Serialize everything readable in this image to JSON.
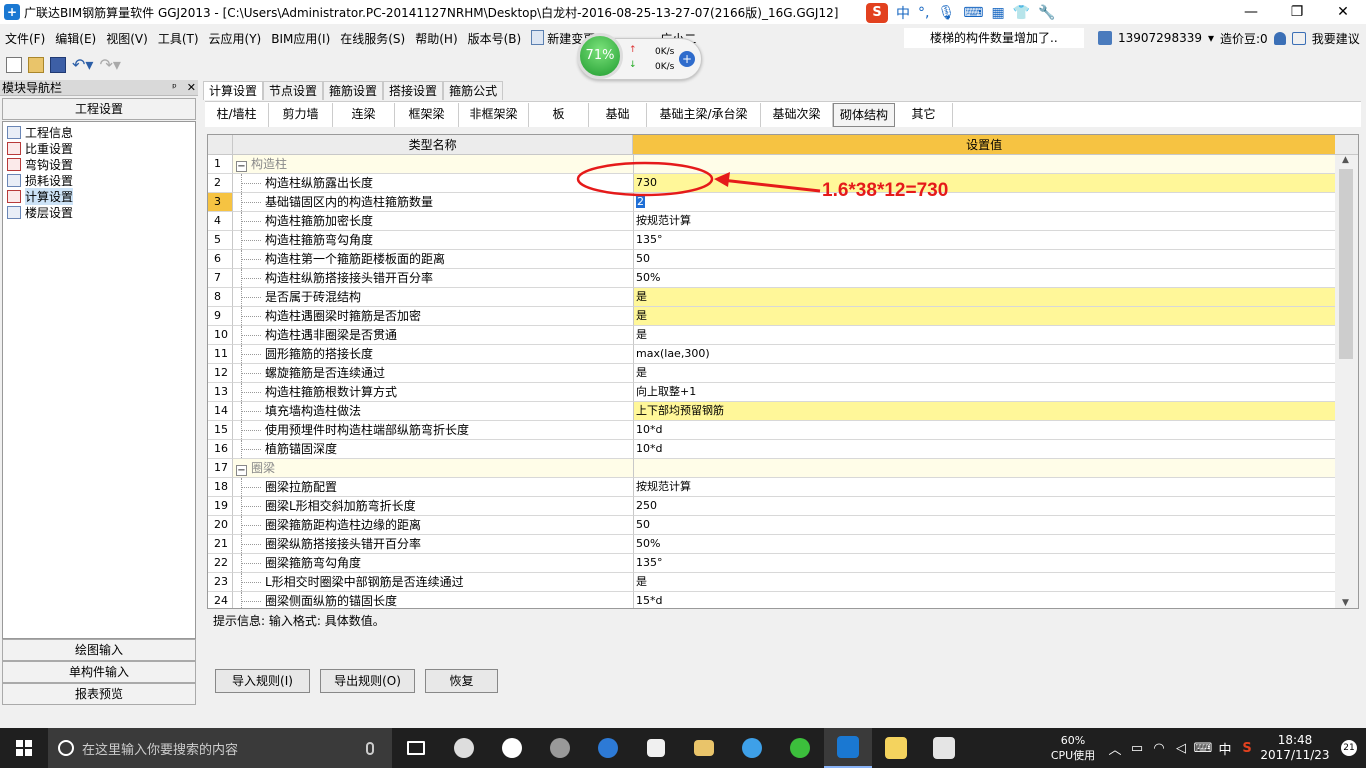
{
  "window": {
    "title": "广联达BIM钢筋算量软件 GGJ2013 - [C:\\Users\\Administrator.PC-20141127NRHM\\Desktop\\白龙村-2016-08-25-13-27-07(2166版)_16G.GGJ12]",
    "ime_items": [
      "中",
      "°,",
      "🎙",
      "⌨",
      "▦",
      "👕",
      "🔧"
    ],
    "minimize": "—",
    "maximize": "❐",
    "close": "✕"
  },
  "menu": {
    "items": [
      "文件(F)",
      "编辑(E)",
      "视图(V)",
      "工具(T)",
      "云应用(Y)",
      "BIM应用(I)",
      "在线服务(S)",
      "帮助(H)",
      "版本号(B)",
      "新建变更",
      "广小二"
    ],
    "notice": "楼梯的构件数量增加了..",
    "phone": "13907298339",
    "cost_beans": "造价豆:0",
    "help": "我要建议"
  },
  "speed": {
    "percent": "71%",
    "up": "0K/s",
    "down": "0K/s",
    "plus": "+"
  },
  "nav": {
    "title": "模块导航栏",
    "pin": "ᵖ",
    "close": "✕",
    "section": "工程设置",
    "items": [
      "工程信息",
      "比重设置",
      "弯钩设置",
      "损耗设置",
      "计算设置",
      "楼层设置"
    ],
    "bottom": [
      "绘图输入",
      "单构件输入",
      "报表预览"
    ]
  },
  "tabs_top": [
    "计算设置",
    "节点设置",
    "箍筋设置",
    "搭接设置",
    "箍筋公式"
  ],
  "tabs_sub": [
    "柱/墙柱",
    "剪力墙",
    "连梁",
    "框架梁",
    "非框架梁",
    "板",
    "基础",
    "基础主梁/承台梁",
    "基础次梁",
    "砌体结构",
    "其它"
  ],
  "grid": {
    "head_name": "类型名称",
    "head_value": "设置值",
    "rows": [
      {
        "n": "1",
        "name": "构造柱",
        "value": "",
        "group": true
      },
      {
        "n": "2",
        "name": "构造柱纵筋露出长度",
        "value": "730",
        "hl": true
      },
      {
        "n": "3",
        "name": "基础锚固区内的构造柱箍筋数量",
        "value": "2",
        "edit": true
      },
      {
        "n": "4",
        "name": "构造柱箍筋加密长度",
        "value": "按规范计算"
      },
      {
        "n": "5",
        "name": "构造柱箍筋弯勾角度",
        "value": "135°"
      },
      {
        "n": "6",
        "name": "构造柱第一个箍筋距楼板面的距离",
        "value": "50"
      },
      {
        "n": "7",
        "name": "构造柱纵筋搭接接头错开百分率",
        "value": "50%"
      },
      {
        "n": "8",
        "name": "是否属于砖混结构",
        "value": "是",
        "hl": true
      },
      {
        "n": "9",
        "name": "构造柱遇圈梁时箍筋是否加密",
        "value": "是",
        "hl": true
      },
      {
        "n": "10",
        "name": "构造柱遇非圈梁是否贯通",
        "value": "是"
      },
      {
        "n": "11",
        "name": "圆形箍筋的搭接长度",
        "value": "max(lae,300)"
      },
      {
        "n": "12",
        "name": "螺旋箍筋是否连续通过",
        "value": "是"
      },
      {
        "n": "13",
        "name": "构造柱箍筋根数计算方式",
        "value": "向上取整+1"
      },
      {
        "n": "14",
        "name": "填充墙构造柱做法",
        "value": "上下部均预留钢筋",
        "hl": true
      },
      {
        "n": "15",
        "name": "使用预埋件时构造柱端部纵筋弯折长度",
        "value": "10*d"
      },
      {
        "n": "16",
        "name": "植筋锚固深度",
        "value": "10*d"
      },
      {
        "n": "17",
        "name": "圈梁",
        "value": "",
        "group": true
      },
      {
        "n": "18",
        "name": "圈梁拉筋配置",
        "value": "按规范计算"
      },
      {
        "n": "19",
        "name": "圈梁L形相交斜加筋弯折长度",
        "value": "250"
      },
      {
        "n": "20",
        "name": "圈梁箍筋距构造柱边缘的距离",
        "value": "50"
      },
      {
        "n": "21",
        "name": "圈梁纵筋搭接接头错开百分率",
        "value": "50%"
      },
      {
        "n": "22",
        "name": "圈梁箍筋弯勾角度",
        "value": "135°"
      },
      {
        "n": "23",
        "name": "L形相交时圈梁中部钢筋是否连续通过",
        "value": "是"
      },
      {
        "n": "24",
        "name": "圈梁侧面纵筋的锚固长度",
        "value": "15*d"
      }
    ]
  },
  "hint": "提示信息: 输入格式: 具体数值。",
  "buttons": {
    "import": "导入规则(I)",
    "export": "导出规则(O)",
    "restore": "恢复"
  },
  "annotation": "1.6*38*12=730",
  "taskbar": {
    "search_placeholder": "在这里输入你要搜索的内容",
    "cpu_pct": "60%",
    "cpu_label": "CPU使用",
    "time": "18:48",
    "date": "2017/11/23",
    "ime": "中",
    "notifications": "21"
  },
  "colors": {
    "header_orange": "#f6c342",
    "highlight_yellow": "#fff799",
    "annotation_red": "#e51a1a"
  }
}
